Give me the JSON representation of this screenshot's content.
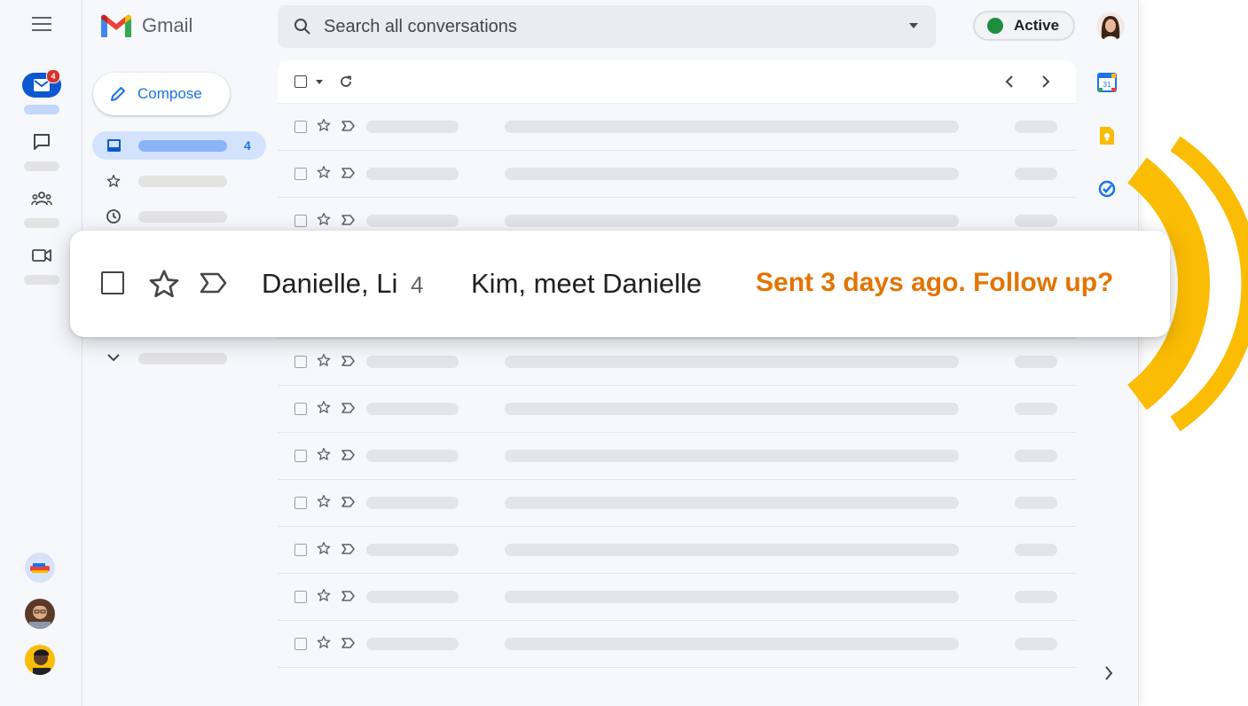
{
  "app": {
    "name": "Gmail"
  },
  "search": {
    "placeholder": "Search all conversations"
  },
  "status": {
    "label": "Active",
    "color": "#1e8e3e"
  },
  "compose": {
    "label": "Compose"
  },
  "rail": {
    "mail_badge": "4",
    "items": [
      "mail-icon",
      "chat-icon",
      "spaces-icon",
      "meet-icon"
    ]
  },
  "nav": {
    "inbox_count": "4"
  },
  "callout": {
    "sender": "Danielle, Li",
    "count": "4",
    "subject": "Kim, meet Danielle",
    "nudge": "Sent 3 days ago. Follow up?",
    "nudge_color": "#e37400"
  },
  "side_panel": {
    "calendar_day": "31"
  },
  "colors": {
    "accent": "#1a73e8",
    "highlight_arc": "#fbbc04",
    "nav_selected": "#d3e3fd"
  }
}
